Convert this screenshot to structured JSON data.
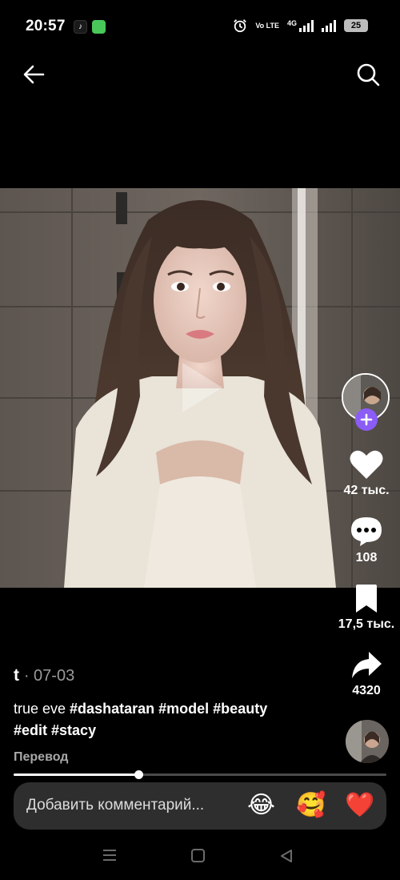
{
  "status_bar": {
    "time": "20:57",
    "network": "4G",
    "volte": "Vo LTE",
    "battery": "25",
    "icons": [
      "tiktok-icon",
      "messages-icon",
      "alarm-icon",
      "signal-icon",
      "battery-icon"
    ]
  },
  "nav": {
    "back_icon": "arrow-left-icon",
    "search_icon": "search-icon"
  },
  "rail": {
    "likes": "42 тыс.",
    "comments": "108",
    "saves": "17,5 тыс.",
    "shares": "4320"
  },
  "post": {
    "author": "t",
    "date": "· 07-03",
    "caption_text": "true eve ",
    "hashtags": [
      "#dashataran",
      "#model",
      "#beauty",
      "#edit",
      "#stacy"
    ],
    "translate": "Перевод",
    "progress": 0.335
  },
  "comment": {
    "placeholder": "Добавить комментарий...",
    "emojis": [
      "😂",
      "🥰",
      "❤️"
    ]
  },
  "colors": {
    "background": "#000000",
    "follow_accent": "#8b5cf6",
    "comment_bar": "#2e2e2e"
  }
}
